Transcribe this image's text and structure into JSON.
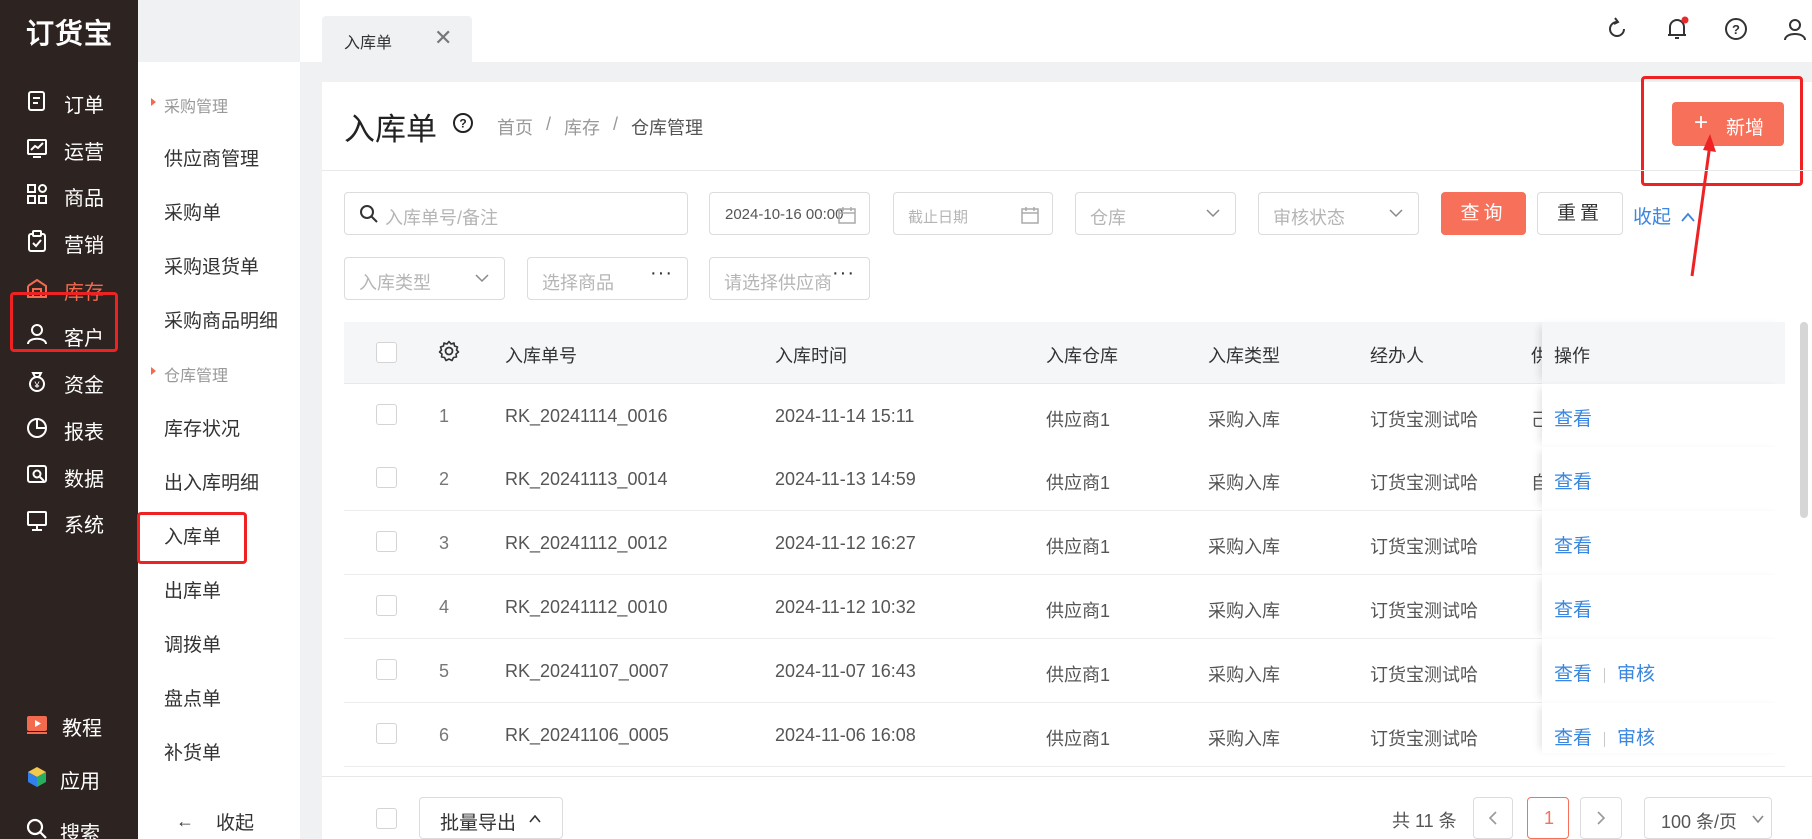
{
  "app": {
    "logo": "订货宝"
  },
  "nav": {
    "items": [
      {
        "label": "订单",
        "icon": "order-icon"
      },
      {
        "label": "运营",
        "icon": "chart-icon"
      },
      {
        "label": "商品",
        "icon": "grid-icon"
      },
      {
        "label": "营销",
        "icon": "clipboard-icon"
      },
      {
        "label": "库存",
        "icon": "warehouse-icon"
      },
      {
        "label": "客户",
        "icon": "user-icon"
      },
      {
        "label": "资金",
        "icon": "money-icon"
      },
      {
        "label": "报表",
        "icon": "pie-icon"
      },
      {
        "label": "数据",
        "icon": "data-search-icon"
      },
      {
        "label": "系统",
        "icon": "monitor-icon"
      }
    ],
    "bottom": [
      {
        "label": "教程",
        "icon": "play-icon"
      },
      {
        "label": "应用",
        "icon": "cube-icon"
      },
      {
        "label": "搜索",
        "icon": "search-icon"
      }
    ],
    "active_color": "#f26b4f"
  },
  "submenu": {
    "group_purchase": "采购管理",
    "purchase_items": [
      "供应商管理",
      "采购单",
      "采购退货单",
      "采购商品明细"
    ],
    "group_warehouse": "仓库管理",
    "warehouse_items": [
      "库存状况",
      "出入库明细",
      "入库单",
      "出库单",
      "调拨单",
      "盘点单",
      "补货单"
    ],
    "collapse": "收起"
  },
  "tabs": [
    {
      "label": "入库单",
      "close": "✕"
    }
  ],
  "page": {
    "title": "入库单",
    "breadcrumb": [
      "首页",
      "库存",
      "仓库管理"
    ],
    "add_button": "新增"
  },
  "filters": {
    "search_placeholder": "入库单号/备注",
    "start_date": "2024-10-16 00:00",
    "end_date_placeholder": "截止日期",
    "warehouse_placeholder": "仓库",
    "audit_placeholder": "审核状态",
    "query": "查询",
    "reset": "重置",
    "collapse": "收起",
    "type_placeholder": "入库类型",
    "product_placeholder": "选择商品",
    "supplier_placeholder": "请选择供应商"
  },
  "table": {
    "columns": [
      "入库单号",
      "入库时间",
      "入库仓库",
      "入库类型",
      "经办人",
      "供",
      "操作"
    ],
    "rows": [
      {
        "no": "1",
        "order": "RK_20241114_0016",
        "time": "2024-11-14 15:11",
        "warehouse": "供应商1",
        "type": "采购入库",
        "handler": "订货宝测试哈",
        "extra": "己",
        "ops": [
          "查看"
        ]
      },
      {
        "no": "2",
        "order": "RK_20241113_0014",
        "time": "2024-11-13 14:59",
        "warehouse": "供应商1",
        "type": "采购入库",
        "handler": "订货宝测试哈",
        "extra": "自",
        "ops": [
          "查看"
        ]
      },
      {
        "no": "3",
        "order": "RK_20241112_0012",
        "time": "2024-11-12 16:27",
        "warehouse": "供应商1",
        "type": "采购入库",
        "handler": "订货宝测试哈",
        "extra": "",
        "ops": [
          "查看"
        ]
      },
      {
        "no": "4",
        "order": "RK_20241112_0010",
        "time": "2024-11-12 10:32",
        "warehouse": "供应商1",
        "type": "采购入库",
        "handler": "订货宝测试哈",
        "extra": "",
        "ops": [
          "查看"
        ]
      },
      {
        "no": "5",
        "order": "RK_20241107_0007",
        "time": "2024-11-07 16:43",
        "warehouse": "供应商1",
        "type": "采购入库",
        "handler": "订货宝测试哈",
        "extra": "",
        "ops": [
          "查看",
          "审核"
        ]
      },
      {
        "no": "6",
        "order": "RK_20241106_0005",
        "time": "2024-11-06 16:08",
        "warehouse": "供应商1",
        "type": "采购入库",
        "handler": "订货宝测试哈",
        "extra": "",
        "ops": [
          "查看",
          "审核"
        ]
      }
    ]
  },
  "footer": {
    "batch_export": "批量导出",
    "total": "共 11 条",
    "current_page": "1",
    "page_size": "100 条/页"
  },
  "colors": {
    "accent": "#f7705a",
    "link": "#3a86e0",
    "nav_bg": "#2d2321",
    "annotation": "#ee2222"
  }
}
